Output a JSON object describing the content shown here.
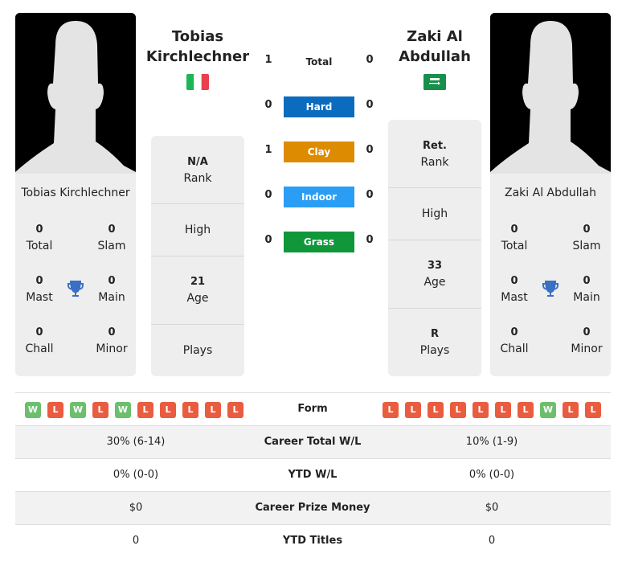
{
  "players": [
    {
      "name": "Tobias Kirchlechner",
      "name_line1": "Tobias",
      "name_line2": "Kirchlechner",
      "country": "Italy",
      "flag_icon": "italy-flag-icon",
      "titles": {
        "total": "0",
        "total_label": "Total",
        "slam": "0",
        "slam_label": "Slam",
        "mast": "0",
        "mast_label": "Mast",
        "main": "0",
        "main_label": "Main",
        "chall": "0",
        "chall_label": "Chall",
        "minor": "0",
        "minor_label": "Minor"
      },
      "info": {
        "rank_value": "N/A",
        "rank_label": "Rank",
        "high_value": "",
        "high_label": "High",
        "age_value": "21",
        "age_label": "Age",
        "plays_value": "",
        "plays_label": "Plays"
      },
      "form": [
        "W",
        "L",
        "W",
        "L",
        "W",
        "L",
        "L",
        "L",
        "L",
        "L"
      ],
      "career_wl": "30% (6-14)",
      "ytd_wl": "0% (0-0)",
      "prize_money": "$0",
      "ytd_titles": "0"
    },
    {
      "name": "Zaki Al Abdullah",
      "name_line1": "Zaki Al",
      "name_line2": "Abdullah",
      "country": "Saudi Arabia",
      "flag_icon": "saudi-arabia-flag-icon",
      "titles": {
        "total": "0",
        "total_label": "Total",
        "slam": "0",
        "slam_label": "Slam",
        "mast": "0",
        "mast_label": "Mast",
        "main": "0",
        "main_label": "Main",
        "chall": "0",
        "chall_label": "Chall",
        "minor": "0",
        "minor_label": "Minor"
      },
      "info": {
        "rank_value": "Ret.",
        "rank_label": "Rank",
        "high_value": "",
        "high_label": "High",
        "age_value": "33",
        "age_label": "Age",
        "plays_value": "R",
        "plays_label": "Plays"
      },
      "form": [
        "L",
        "L",
        "L",
        "L",
        "L",
        "L",
        "L",
        "W",
        "L",
        "L"
      ],
      "career_wl": "10% (1-9)",
      "ytd_wl": "0% (0-0)",
      "prize_money": "$0",
      "ytd_titles": "0"
    }
  ],
  "h2h": {
    "total": {
      "label": "Total",
      "p1": "1",
      "p2": "0"
    },
    "surfaces": [
      {
        "label": "Hard",
        "p1": "0",
        "p2": "0",
        "color": "#0b6bbf"
      },
      {
        "label": "Clay",
        "p1": "1",
        "p2": "0",
        "color": "#dd8b00"
      },
      {
        "label": "Indoor",
        "p1": "0",
        "p2": "0",
        "color": "#2a9df4"
      },
      {
        "label": "Grass",
        "p1": "0",
        "p2": "0",
        "color": "#0f973a"
      }
    ]
  },
  "table": {
    "form_label": "Form",
    "career_label": "Career Total W/L",
    "ytd_label": "YTD W/L",
    "prize_label": "Career Prize Money",
    "titles_label": "YTD Titles"
  }
}
